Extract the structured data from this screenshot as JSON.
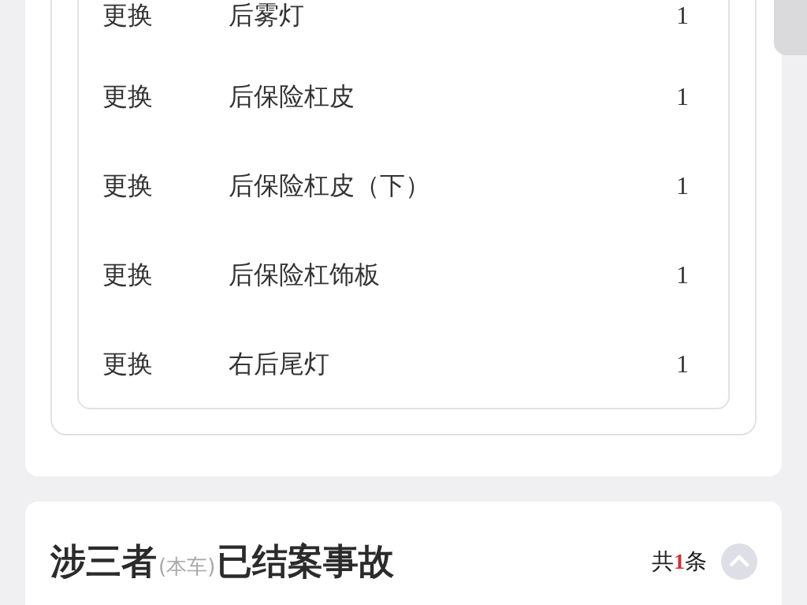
{
  "parts_table": {
    "rows": [
      [
        "更换",
        "后雾灯",
        "1"
      ],
      [
        "更换",
        "后保险杠皮",
        "1"
      ],
      [
        "更换",
        "后保险杠皮（下）",
        "1"
      ],
      [
        "更换",
        "后保险杠饰板",
        "1"
      ],
      [
        "更换",
        "右后尾灯",
        "1"
      ]
    ]
  },
  "closed_accidents": {
    "title": "涉三者",
    "title_note": "(本车)",
    "title_end": "已结案事故",
    "count_prefix": "共",
    "count": "1",
    "count_suffix": "条"
  }
}
